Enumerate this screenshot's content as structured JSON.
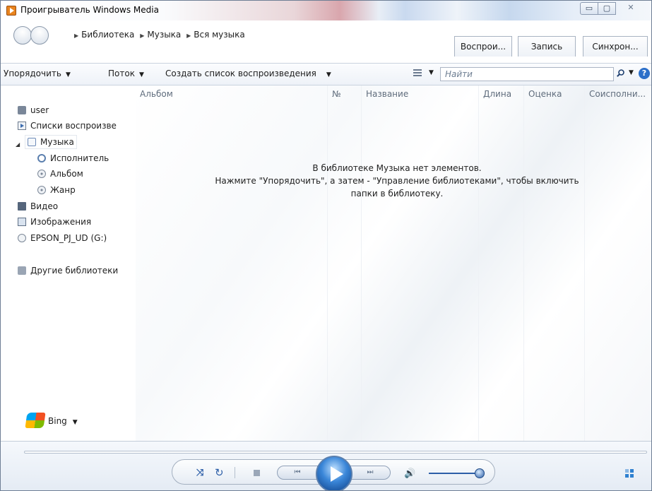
{
  "window": {
    "title": "Проигрыватель Windows Media",
    "min_glyph": "▭",
    "max_glyph": "▢",
    "close_glyph": "✕"
  },
  "nav": {
    "breadcrumb": [
      "Библиотека",
      "Музыка",
      "Вся музыка"
    ],
    "tabs": [
      "Воспрои...",
      "Запись",
      "Синхрон..."
    ]
  },
  "toolbar": {
    "organize": "Упорядочить",
    "stream": "Поток",
    "create_playlist": "Создать список воспроизведения",
    "search_placeholder": "Найти"
  },
  "sidebar": {
    "items": [
      {
        "label": "user",
        "icon": "user-icon"
      },
      {
        "label": "Списки воспроизве",
        "icon": "playlist-icon"
      },
      {
        "label": "Музыка",
        "icon": "music-icon"
      },
      {
        "label": "Исполнитель",
        "icon": "artist-icon"
      },
      {
        "label": "Альбом",
        "icon": "album-icon"
      },
      {
        "label": "Жанр",
        "icon": "genre-icon"
      },
      {
        "label": "Видео",
        "icon": "video-icon"
      },
      {
        "label": "Изображения",
        "icon": "image-icon"
      },
      {
        "label": "EPSON_PJ_UD (G:)",
        "icon": "drive-icon"
      },
      {
        "label": "Другие библиотеки",
        "icon": "other-libraries-icon"
      }
    ],
    "bing_label": "Bing"
  },
  "content": {
    "columns": [
      "Альбом",
      "№",
      "Название",
      "Длина",
      "Оценка",
      "Соисполни..."
    ],
    "empty_line1": "В библиотеке Музыка нет элементов.",
    "empty_line2": "Нажмите \"Упорядочить\", а затем - \"Управление библиотеками\", чтобы включить",
    "empty_line3": "папки в библиотеку."
  },
  "player": {
    "shuffle_glyph": "⤨",
    "repeat_glyph": "↻",
    "prev_glyph": "⏮",
    "next_glyph": "⏭",
    "volume_glyph": "🔊",
    "volume_level_percent": 90
  },
  "colors": {
    "accent": "#2d5fa8",
    "play_button": "#3a86d8",
    "title_glow": "#d9a6ad"
  }
}
